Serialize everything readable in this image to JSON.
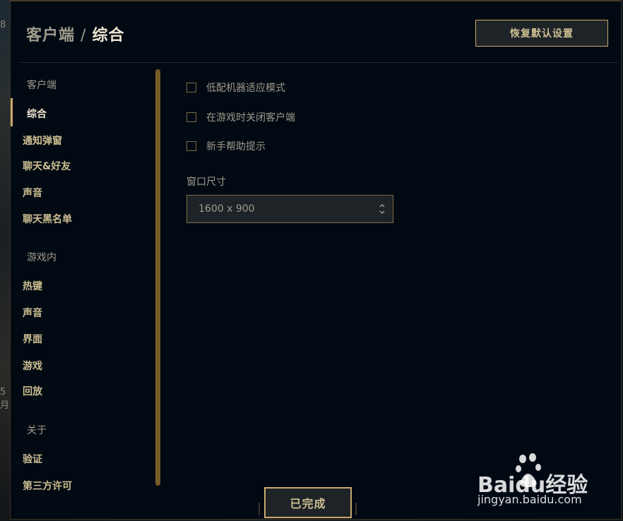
{
  "title": {
    "crumb": "客户端",
    "separator": "/",
    "current": "综合"
  },
  "reset_button": "恢复默认设置",
  "sidebar": {
    "sections": [
      {
        "heading": "客户端",
        "items": [
          "综合",
          "通知弹窗",
          "聊天&好友",
          "声音",
          "聊天黑名单"
        ]
      },
      {
        "heading": "游戏内",
        "items": [
          "热键",
          "声音",
          "界面",
          "游戏",
          "回放"
        ]
      },
      {
        "heading": "关于",
        "items": [
          "验证",
          "第三方许可"
        ]
      }
    ],
    "active_item": "综合"
  },
  "options": [
    {
      "label": "低配机器适应模式",
      "checked": false
    },
    {
      "label": "在游戏时关闭客户端",
      "checked": false
    },
    {
      "label": "新手帮助提示",
      "checked": false
    }
  ],
  "window_size": {
    "label": "窗口尺寸",
    "value": "1600 x 900"
  },
  "done_button": "已完成",
  "background_fragments": [
    "8",
    "5月"
  ],
  "watermark": {
    "brand": "Baidu经验",
    "url": "jingyan.baidu.com"
  },
  "colors": {
    "background": "#010a13",
    "gold": "#c8aa6e",
    "gold_text": "#cdbe91",
    "label_gray": "#a09b8c",
    "bright_text": "#f0e6d2",
    "scroll": "#785a28"
  }
}
